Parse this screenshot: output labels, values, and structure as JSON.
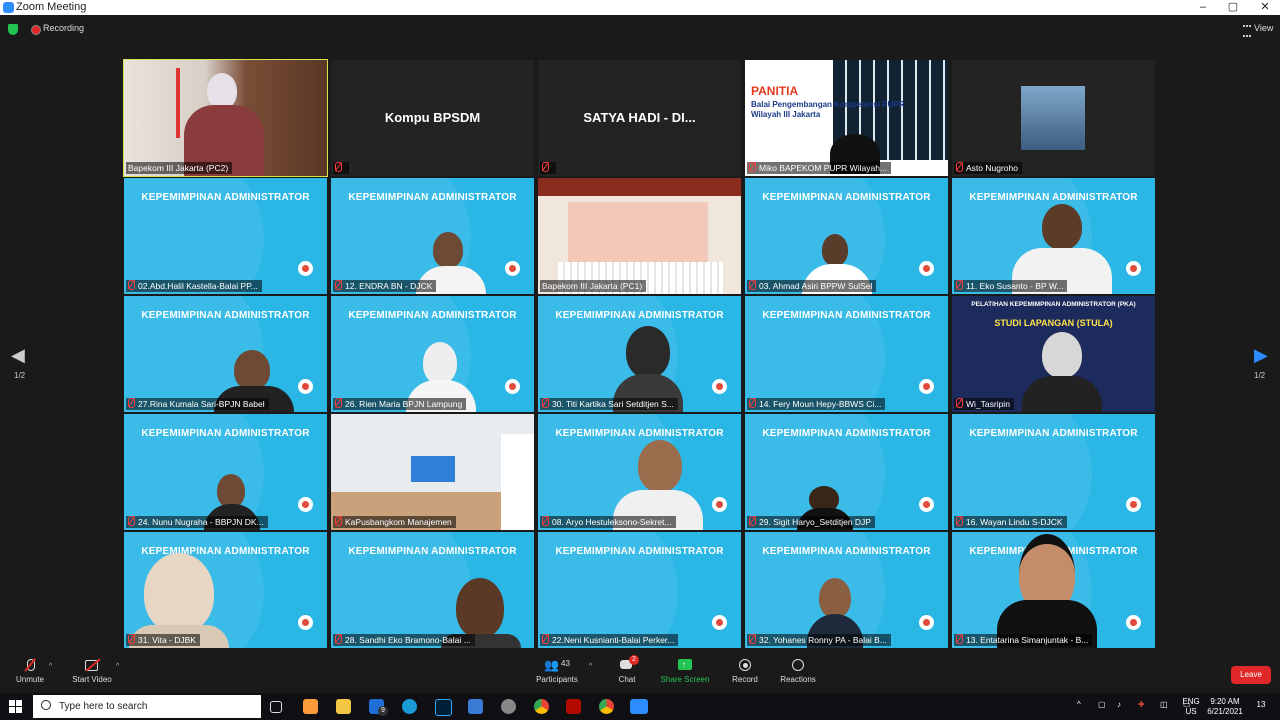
{
  "window": {
    "title": "Zoom Meeting",
    "minimize": "–",
    "restore": "▢",
    "close": "✕"
  },
  "topbar": {
    "recording_label": "Recording",
    "view_label": "View"
  },
  "banner_text": "KEPEMIMPINAN ADMINISTRATOR",
  "tiles": {
    "t1": "Bapekom III Jakarta (PC2)",
    "t2": "",
    "t2_big": "Kompu BPSDM",
    "t3": "",
    "t3_big": "SATYA HADI - DI...",
    "t4": "Miko BAPEKOM PUPR Wilayah...",
    "t4_slide_title": "PANITIA",
    "t4_slide_sub": "Balai Pengembangan Kompetensi PUPR Wilayah III Jakarta",
    "t5": "Asto Nugroho",
    "t6": "02.Abd.Halil Kastella-Balai PP...",
    "t7": "12. ENDRA BN - DJCK",
    "t8": "Bapekom III Jakarta (PC1)",
    "t9": "03. Ahmad Asiri BPPW SulSel",
    "t10": "11. Eko Susanto - BP W...",
    "t11": "27.Rina Kumala Sari-BPJN Babel",
    "t12": "26. Rien Maria BPJN Lampung",
    "t13": "30. Titi Kartika Sari Setditjen S...",
    "t14": "14. Fery Moun Hepy-BBWS Ci...",
    "t15": "Wi_Tasripin",
    "t15_banner": "PELATIHAN KEPEMIMPINAN ADMINISTRATOR (PKA)",
    "t15_sub": "STUDI LAPANGAN (STULA)",
    "t16": "24. Nunu Nugraha - BBPJN DK...",
    "t17": "KaPusbangkom Manajemen",
    "t18": "08. Aryo Hestuleksono-Sekret...",
    "t19": "29. Sigit Haryo_Setditjen DJP",
    "t20": "16. Wayan Lindu S-DJCK",
    "t21": "31. Vita - DJBK",
    "t22": "28. Sandhi Eko Bramono-Balai ...",
    "t23": "22.Neni Kusnianti-Balai Perker...",
    "t24": "32. Yohanes Ronny PA - Balai B...",
    "t25": "13. Entatarina Simanjuntak - B..."
  },
  "pagination": {
    "left": "1/2",
    "right": "1/2"
  },
  "toolbar": {
    "unmute": "Unmute",
    "start_video": "Start Video",
    "participants": "Participants",
    "participants_count": "43",
    "chat": "Chat",
    "chat_badge": "2",
    "share_screen": "Share Screen",
    "record": "Record",
    "reactions": "Reactions",
    "leave": "Leave"
  },
  "taskbar": {
    "search_placeholder": "Type here to search",
    "mail_badge": "9",
    "lang_top": "ENG",
    "lang_bottom": "US",
    "time": "9:20 AM",
    "date": "6/21/2021",
    "notif": "13"
  },
  "colors": {
    "accent": "#2d8cff",
    "leave": "#e02828",
    "share": "#23c552",
    "active_speaker": "#d8e34a",
    "tile_blue": "#2bb7e6"
  }
}
